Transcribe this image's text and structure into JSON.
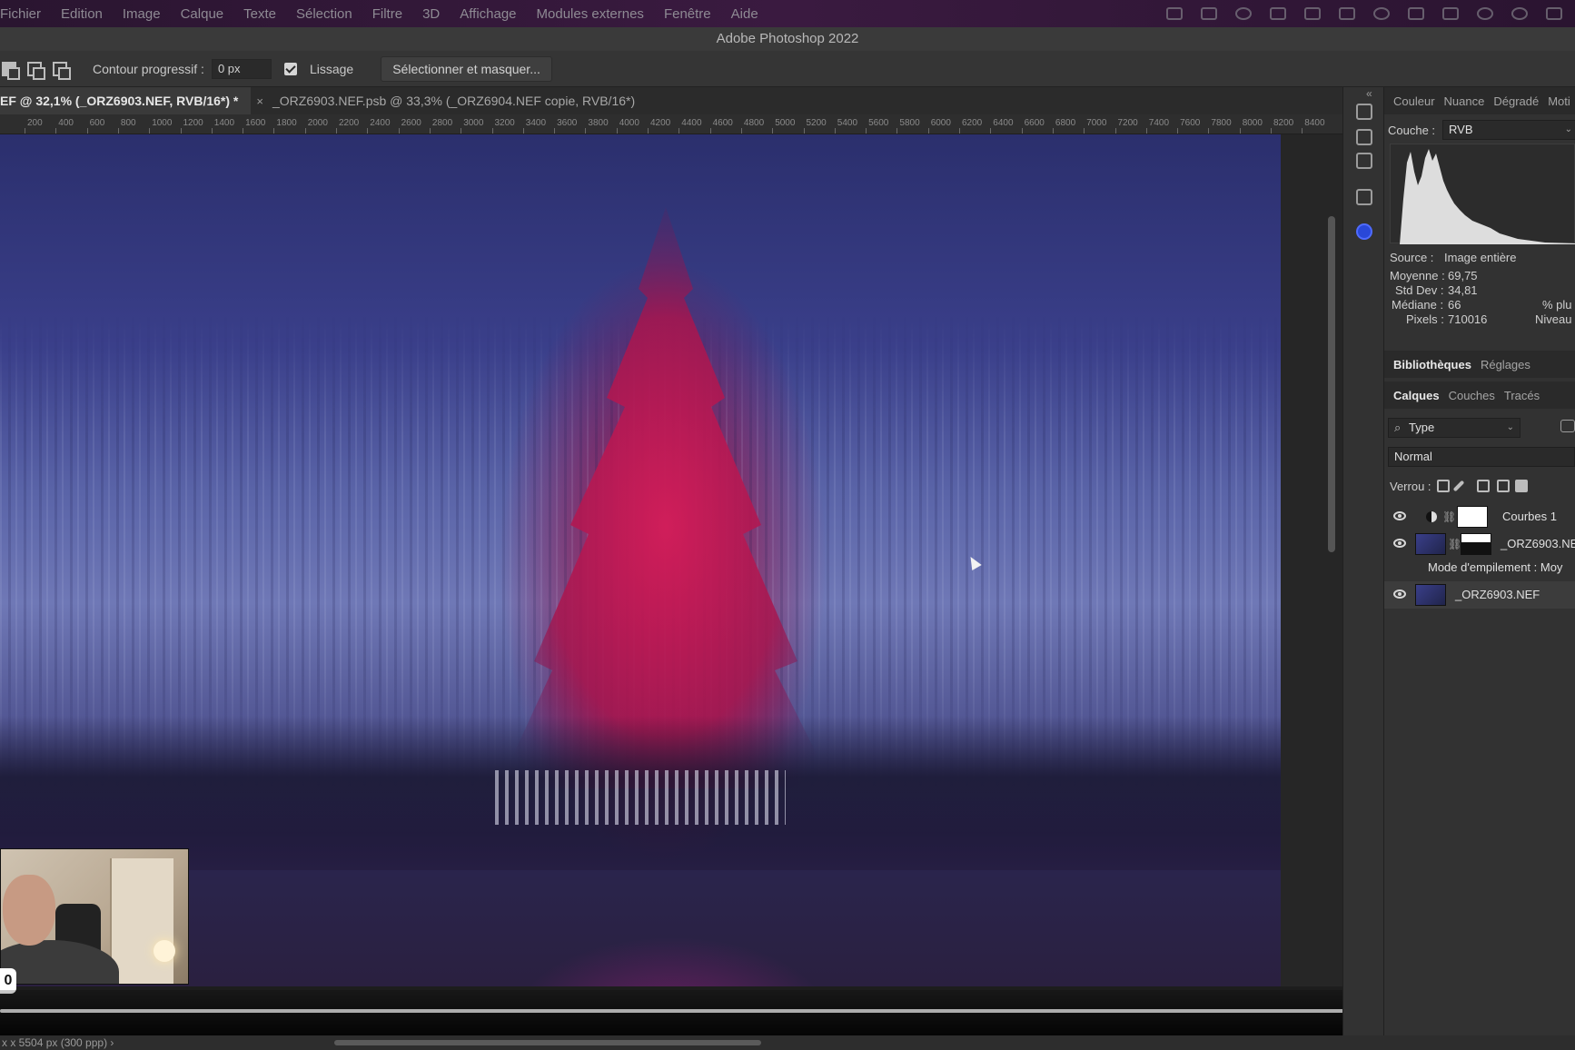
{
  "menubar": {
    "items": [
      "Fichier",
      "Edition",
      "Image",
      "Calque",
      "Texte",
      "Sélection",
      "Filtre",
      "3D",
      "Affichage",
      "Modules externes",
      "Fenêtre",
      "Aide"
    ]
  },
  "window": {
    "title": "Adobe Photoshop 2022"
  },
  "options": {
    "feather_label": "Contour progressif :",
    "feather_value": "0 px",
    "antialias_label": "Lissage",
    "select_mask_button": "Sélectionner et masquer..."
  },
  "tabs": [
    {
      "label": "EF @ 32,1% (_ORZ6903.NEF, RVB/16*) *",
      "active": true
    },
    {
      "label": "_ORZ6903.NEF.psb @ 33,3% (_ORZ6904.NEF copie, RVB/16*)",
      "active": false
    }
  ],
  "ruler": {
    "ticks": [
      "200",
      "400",
      "600",
      "800",
      "1000",
      "1200",
      "1400",
      "1600",
      "1800",
      "2000",
      "2200",
      "2400",
      "2600",
      "2800",
      "3000",
      "3200",
      "3400",
      "3600",
      "3800",
      "4000",
      "4200",
      "4400",
      "4600",
      "4800",
      "5000",
      "5200",
      "5400",
      "5600",
      "5800",
      "6000",
      "6200",
      "6400",
      "6600",
      "6800",
      "7000",
      "7200",
      "7400",
      "7600",
      "7800",
      "8000",
      "8200",
      "8400"
    ]
  },
  "video": {
    "time_fragment": "0",
    "progress": 0.9
  },
  "statusbar": {
    "text": "x x 5504 px (300 ppp)",
    "chevron": "›"
  },
  "panel_top": {
    "tabs": [
      "Couleur",
      "Nuance",
      "Dégradé",
      "Moti"
    ],
    "channel_label": "Couche :",
    "channel_value": "RVB",
    "source_label": "Source :",
    "source_value": "Image entière",
    "stats": [
      {
        "label": "Moyenne :",
        "value": "69,75"
      },
      {
        "label": "Std Dev :",
        "value": "34,81"
      },
      {
        "label": "Médiane :",
        "value": "66"
      },
      {
        "label": "Pixels :",
        "value": "710016"
      }
    ],
    "right_labels": [
      "% plu",
      "Niveau"
    ]
  },
  "panel_mid": {
    "tabs": [
      "Bibliothèques",
      "Réglages"
    ]
  },
  "layers_panel": {
    "tabs": [
      "Calques",
      "Couches",
      "Tracés"
    ],
    "filter_value": "Type",
    "blend_mode": "Normal",
    "lock_label": "Verrou :",
    "layers": [
      {
        "name": "Courbes 1"
      },
      {
        "name": "_ORZ6903.NE"
      },
      {
        "name": "Mode d'empilement : Moy"
      },
      {
        "name": "_ORZ6903.NEF"
      }
    ]
  },
  "colors": {
    "accent": "#2948d8",
    "tree": "#be1450",
    "sky": "#3a3f8a"
  }
}
